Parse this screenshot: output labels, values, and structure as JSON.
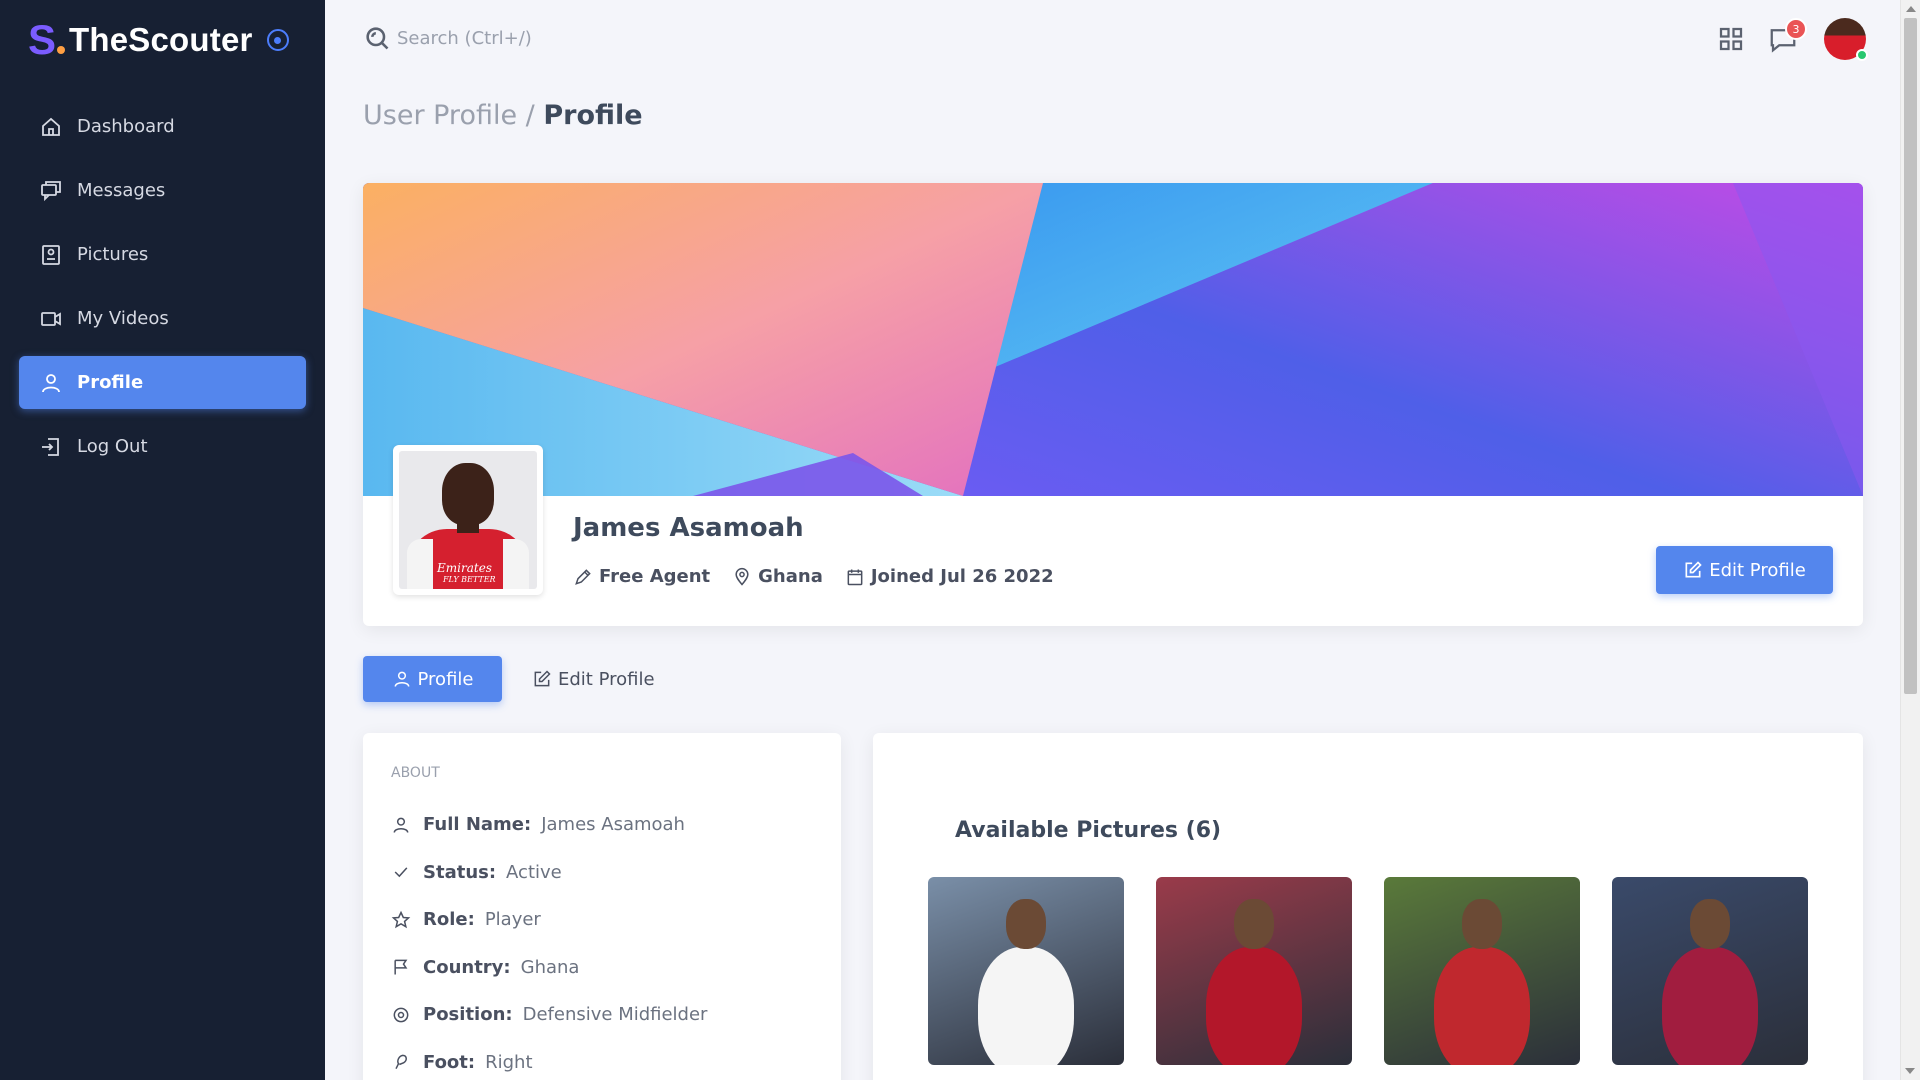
{
  "brand": {
    "name": "TheScouter",
    "logo_letter": "S"
  },
  "sidebar": {
    "items": [
      {
        "label": "Dashboard",
        "icon": "home-icon"
      },
      {
        "label": "Messages",
        "icon": "messages-icon"
      },
      {
        "label": "Pictures",
        "icon": "image-icon"
      },
      {
        "label": "My Videos",
        "icon": "video-icon"
      },
      {
        "label": "Profile",
        "icon": "user-icon",
        "active": true
      },
      {
        "label": "Log Out",
        "icon": "logout-icon"
      }
    ]
  },
  "topbar": {
    "search_placeholder": "Search (Ctrl+/)",
    "notification_count": "3"
  },
  "breadcrumb": {
    "parent": "User Profile",
    "separator": "/",
    "current": "Profile"
  },
  "profile": {
    "name": "James Asamoah",
    "status": "Free Agent",
    "location": "Ghana",
    "joined": "Joined Jul 26 2022",
    "edit_button": "Edit Profile",
    "avatar_logo_text": "Emirates",
    "avatar_logo_sub": "FLY BETTER"
  },
  "tabs": [
    {
      "label": "Profile",
      "active": true
    },
    {
      "label": "Edit Profile",
      "active": false
    }
  ],
  "about": {
    "title": "ABOUT",
    "rows": [
      {
        "key": "Full Name:",
        "value": "James Asamoah",
        "icon": "user-icon"
      },
      {
        "key": "Status:",
        "value": "Active",
        "icon": "check-icon"
      },
      {
        "key": "Role:",
        "value": "Player",
        "icon": "star-icon"
      },
      {
        "key": "Country:",
        "value": "Ghana",
        "icon": "flag-icon"
      },
      {
        "key": "Position:",
        "value": "Defensive Midfielder",
        "icon": "target-icon"
      },
      {
        "key": "Foot:",
        "value": "Right",
        "icon": "foot-icon"
      }
    ]
  },
  "pictures": {
    "title": "Available Pictures (6)",
    "items": [
      {
        "name": "picture-1",
        "bg": "#7a8fa8",
        "kit": "#f5f5f5"
      },
      {
        "name": "picture-2",
        "bg": "#9a3b4a",
        "kit": "#b3172a"
      },
      {
        "name": "picture-3",
        "bg": "#5a7a3a",
        "kit": "#c0282e"
      },
      {
        "name": "picture-4",
        "bg": "#3a4a6a",
        "kit": "#a11d3f"
      }
    ]
  },
  "colors": {
    "sidebar_bg": "#172033",
    "accent": "#5486ed",
    "brand_purple": "#7b5cff",
    "badge": "#ea5455",
    "online": "#28c76f"
  }
}
